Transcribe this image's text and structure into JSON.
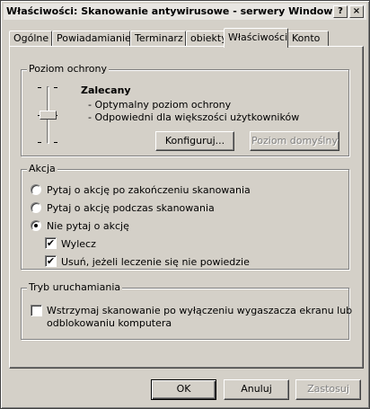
{
  "window": {
    "title": "Właściwości: Skanowanie antywirusowe - serwery Windows",
    "help_button": "?",
    "close_button": "×"
  },
  "tabs": [
    {
      "label": "Ogólne",
      "active": false
    },
    {
      "label": "Powiadamianie",
      "active": false
    },
    {
      "label": "Terminarz",
      "active": false
    },
    {
      "label": "obiekty",
      "active": false
    },
    {
      "label": "Właściwości",
      "active": true
    },
    {
      "label": "Konto",
      "active": false
    }
  ],
  "protection": {
    "group_title": "Poziom ochrony",
    "level_name": "Zalecany",
    "descriptions": [
      "- Optymalny poziom ochrony",
      "- Odpowiedni dla większości użytkowników"
    ],
    "configure_button": "Konfiguruj...",
    "default_level_button": "Poziom domyślny",
    "slider_level": "2 of 3"
  },
  "action": {
    "group_title": "Akcja",
    "radios": [
      {
        "label": "Pytaj o akcję po zakończeniu skanowania",
        "checked": false
      },
      {
        "label": "Pytaj o akcję podczas skanowania",
        "checked": false
      },
      {
        "label": "Nie pytaj o akcję",
        "checked": true
      }
    ],
    "checkboxes": [
      {
        "label": "Wylecz",
        "checked": true
      },
      {
        "label": "Usuń, jeżeli leczenie się nie powiedzie",
        "checked": true
      }
    ]
  },
  "run_mode": {
    "group_title": "Tryb uruchamiania",
    "checkbox_line1": "Wstrzymaj skanowanie po wyłączeniu wygaszacza ekranu lub",
    "checkbox_line2": "odblokowaniu komputera",
    "checked": false
  },
  "footer": {
    "ok": "OK",
    "cancel": "Anuluj",
    "apply": "Zastosuj"
  },
  "check_mark": "✔"
}
